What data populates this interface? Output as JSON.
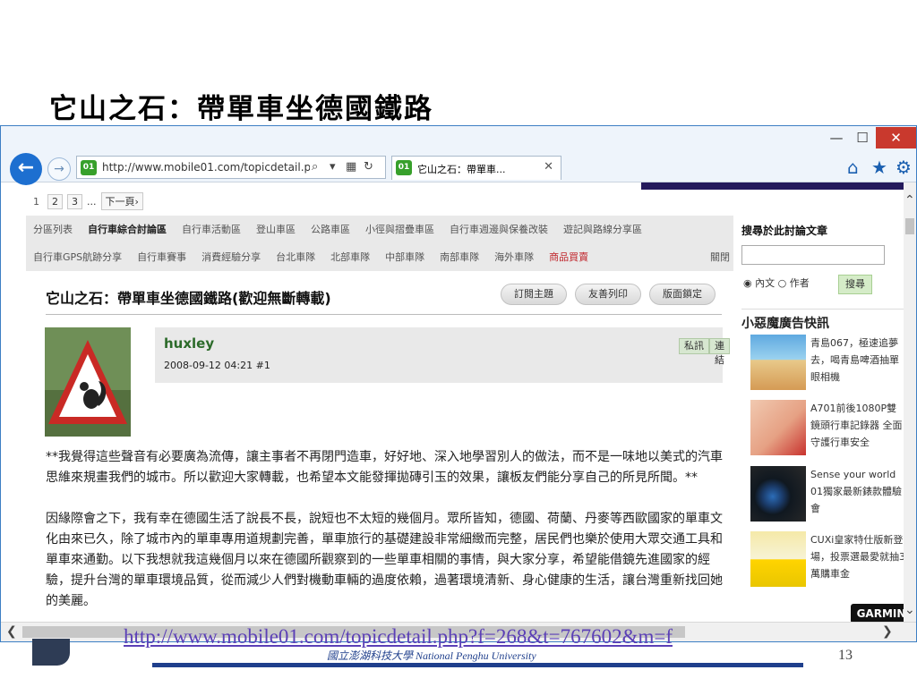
{
  "slide": {
    "title": "它山之石：帶單車坐德國鐵路",
    "footer_link": "http://www.mobile01.com/topicdetail.php?f=268&t=767602&m=f",
    "university": "國立澎湖科技大學  National Penghu University",
    "page_number": "13"
  },
  "browser": {
    "url": "http://www.mobile01.com/topicdetail.p",
    "tab_title": "它山之石：帶單車...",
    "site_icon": "01"
  },
  "page": {
    "pager": [
      "1",
      "2",
      "3",
      "...",
      "下一頁›"
    ],
    "menu_row1": [
      "分區列表",
      "自行車綜合討論區",
      "自行車活動區",
      "登山車區",
      "公路車區",
      "小徑與摺疊車區",
      "自行車週邊與保養改裝",
      "遊記與路線分享區"
    ],
    "menu_row2": [
      "自行車GPS航跡分享",
      "自行車賽事",
      "消費經驗分享",
      "台北車隊",
      "北部車隊",
      "中部車隊",
      "南部車隊",
      "海外車隊",
      "商品買賣"
    ],
    "menu_close": "關閉",
    "thread_title": "它山之石：帶單車坐德國鐵路(歡迎無斷轉載)",
    "buttons": [
      "訂閱主題",
      "友善列印",
      "版面鎖定"
    ],
    "author": "huxley",
    "post_date": "2008-09-12 04:21  #1",
    "tags": [
      "私訊",
      "連結"
    ],
    "paragraph1": "**我覺得這些聲音有必要廣為流傳，讓主事者不再閉門造車，好好地、深入地學習別人的做法，而不是一味地以美式的汽車思維來規畫我們的城市。所以歡迎大家轉載，也希望本文能發揮拋磚引玉的效果，讓板友們能分享自己的所見所聞。**",
    "paragraph2": "因緣際會之下，我有幸在德國生活了說長不長，說短也不太短的幾個月。眾所皆知，德國、荷蘭、丹麥等西歐國家的單車文化由來已久，除了城市內的單車專用道規劃完善，單車旅行的基礎建設非常細緻而完整，居民們也樂於使用大眾交通工具和單車來通勤。以下我想就我這幾個月以來在德國所觀察到的一些單車相關的事情，與大家分享，希望能借鏡先進國家的經驗，提升台灣的單車環境品質，從而減少人們對機動車輛的過度依賴，過著環境清新、身心健康的生活，讓台灣重新找回她的美麗。",
    "sidebar": {
      "search_heading": "搜尋於此討論文章",
      "radio1": "內文",
      "radio2": "作者",
      "search_button": "搜尋",
      "ad_heading": "小惡魔廣告快訊",
      "ads": [
        "青島067，極速追夢去，喝青島啤酒抽單眼相機",
        "A701前後1080P雙鏡頭行車記錄器 全面守護行車安全",
        "Sense your world 01獨家最新錶款體驗會",
        "CUXi皇家特仕版新登場，投票選最愛就抽3萬購車金"
      ],
      "garmin": "GARMIN"
    }
  },
  "colors": {
    "accent": "#1d6fd0",
    "close": "#c9392d",
    "author": "#2c6b2a",
    "link": "#5b3fb6",
    "footer_line": "#1f3f8c"
  }
}
